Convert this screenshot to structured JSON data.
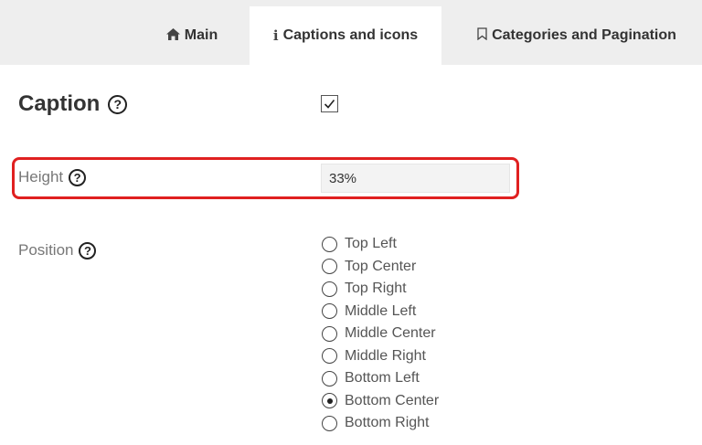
{
  "tabs": {
    "main": {
      "label": "Main",
      "icon": "home-icon"
    },
    "captions": {
      "label": "Captions and icons",
      "icon": "info-icon"
    },
    "categories": {
      "label": "Categories and Pagination",
      "icon": "bookmark-icon"
    }
  },
  "caption": {
    "label": "Caption",
    "help": "?",
    "checked": true
  },
  "height": {
    "label": "Height",
    "help": "?",
    "value": "33%"
  },
  "position": {
    "label": "Position",
    "help": "?",
    "selected": "Bottom Center",
    "options": [
      "Top Left",
      "Top Center",
      "Top Right",
      "Middle Left",
      "Middle Center",
      "Middle Right",
      "Bottom Left",
      "Bottom Center",
      "Bottom Right"
    ]
  },
  "colors": {
    "highlight": "#e02020",
    "tabbar": "#eeeeee"
  }
}
